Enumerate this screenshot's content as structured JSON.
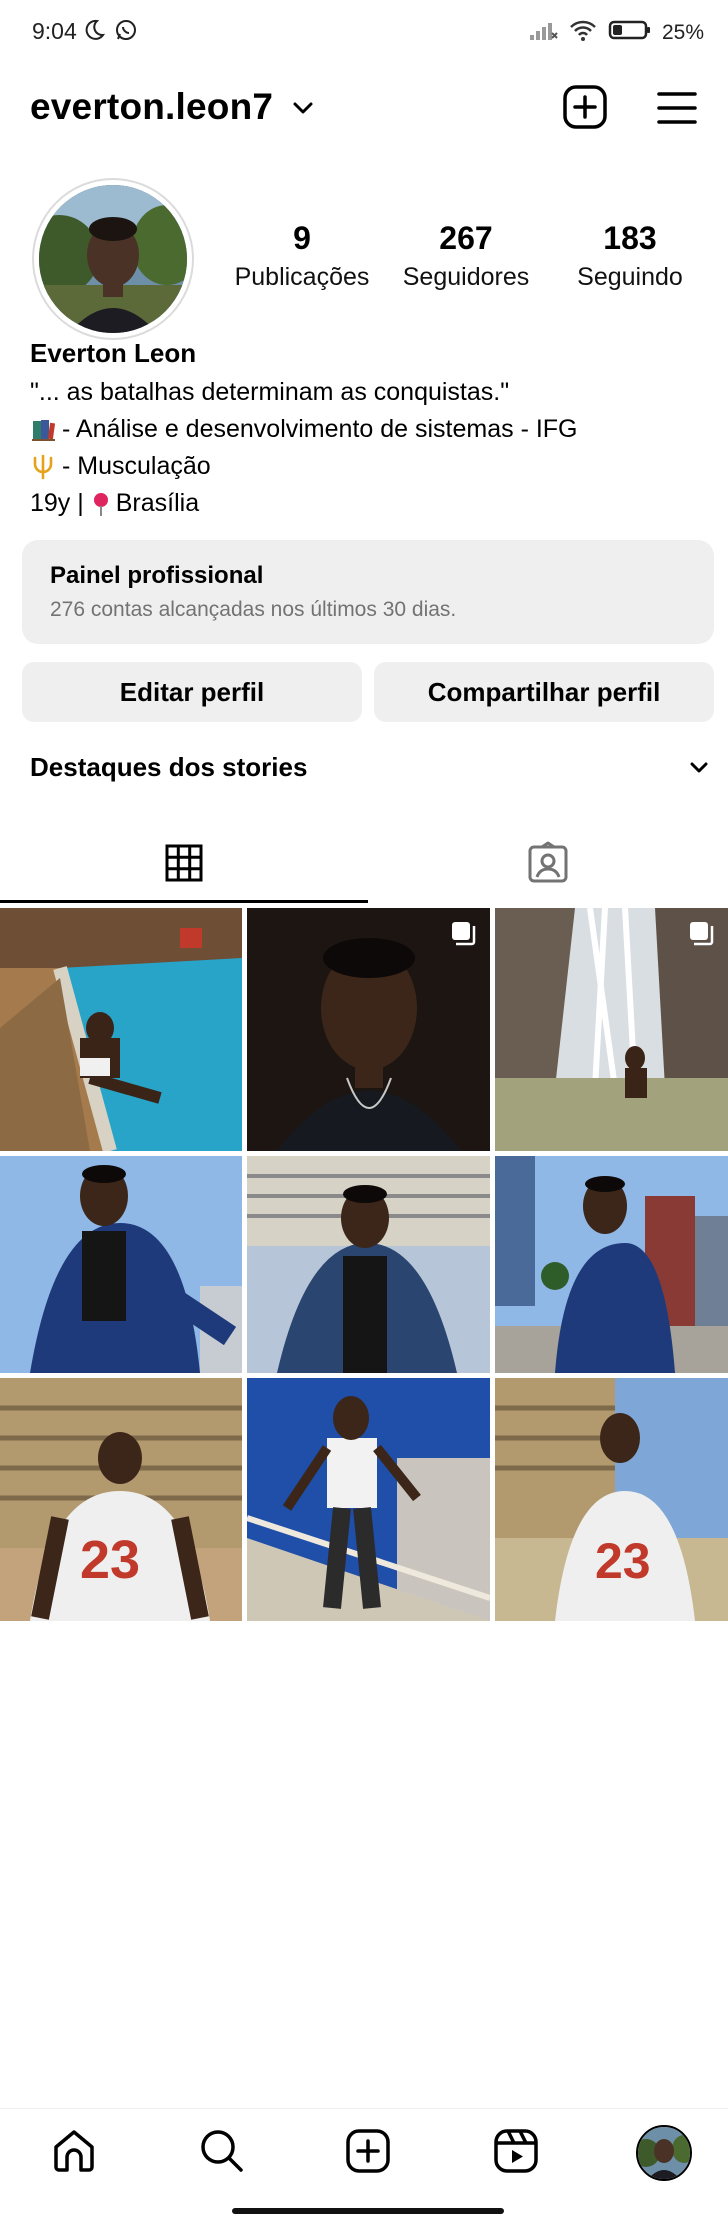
{
  "status_bar": {
    "time": "9:04",
    "battery": "25%"
  },
  "header": {
    "username": "everton.leon7"
  },
  "profile": {
    "stats": [
      {
        "value": "9",
        "label": "Publicações"
      },
      {
        "value": "267",
        "label": "Seguidores"
      },
      {
        "value": "183",
        "label": "Seguindo"
      }
    ],
    "name": "Everton Leon",
    "bio_quote": "\"... as batalhas determinam as conquistas.\"",
    "bio_line2": "- Análise e desenvolvimento de sistemas - IFG",
    "bio_line3": "- Musculação",
    "bio_line4_prefix": "19y |",
    "bio_line4_suffix": "Brasília"
  },
  "professional_panel": {
    "title": "Painel profissional",
    "subtitle": "276 contas alcançadas nos últimos 30 dias."
  },
  "buttons": {
    "edit": "Editar perfil",
    "share": "Compartilhar perfil"
  },
  "highlights": {
    "title": "Destaques dos stories"
  },
  "tabs": [
    {
      "icon": "grid-icon",
      "active": true
    },
    {
      "icon": "tagged-icon",
      "active": false
    }
  ],
  "posts": [
    {
      "desc": "pool",
      "multi": false
    },
    {
      "desc": "selfie",
      "multi": true
    },
    {
      "desc": "waterfall",
      "multi": true
    },
    {
      "desc": "denim-jacket-1",
      "multi": false
    },
    {
      "desc": "denim-jacket-2",
      "multi": false
    },
    {
      "desc": "denim-jacket-3",
      "multi": false
    },
    {
      "desc": "jersey-back",
      "multi": false
    },
    {
      "desc": "stairs",
      "multi": false
    },
    {
      "desc": "jersey-walk",
      "multi": false
    }
  ],
  "nav": [
    "home-icon",
    "search-icon",
    "create-icon",
    "reels-icon",
    "profile-avatar"
  ],
  "colors": {
    "button_bg": "#efefef",
    "muted_text": "#737373"
  }
}
